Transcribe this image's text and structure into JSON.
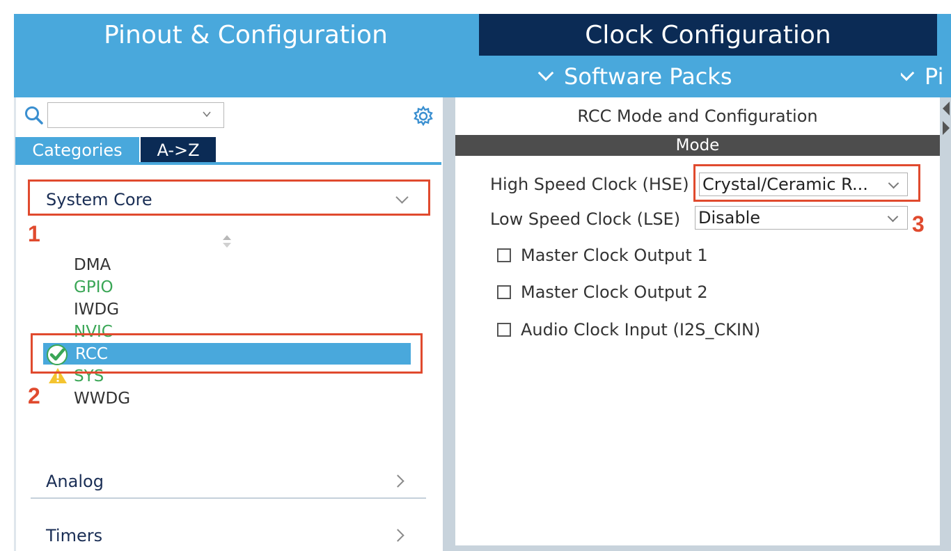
{
  "tabs": {
    "pinout": "Pinout & Configuration",
    "clock": "Clock Configuration"
  },
  "subbar": {
    "software_packs": "Software Packs",
    "pinout_partial": "Pi"
  },
  "left": {
    "search": {
      "value": "",
      "placeholder": ""
    },
    "view_tabs": {
      "categories": "Categories",
      "az": "A->Z"
    },
    "categories": [
      {
        "label": "System Core",
        "expanded": true
      },
      {
        "label": "Analog",
        "expanded": false
      },
      {
        "label": "Timers",
        "expanded": false
      }
    ],
    "peripherals": [
      {
        "label": "DMA",
        "color": "#333333",
        "status": "none"
      },
      {
        "label": "GPIO",
        "color": "#3aa656",
        "status": "none"
      },
      {
        "label": "IWDG",
        "color": "#333333",
        "status": "none"
      },
      {
        "label": "NVIC",
        "color": "#3aa656",
        "status": "none"
      },
      {
        "label": "RCC",
        "color": "#ffffff",
        "status": "ok-check",
        "selected": true
      },
      {
        "label": "SYS",
        "color": "#3aa656",
        "status": "warning"
      },
      {
        "label": "WWDG",
        "color": "#333333",
        "status": "none"
      }
    ]
  },
  "annotations": {
    "n1": "1",
    "n2": "2",
    "n3": "3",
    "color": "#e04a2e"
  },
  "right": {
    "title": "RCC Mode and Configuration",
    "mode_header": "Mode",
    "hse_label": "High Speed Clock (HSE)",
    "hse_value": "Crystal/Ceramic R...",
    "lse_label": "Low Speed Clock (LSE)",
    "lse_value": "Disable",
    "checkboxes": [
      {
        "label": "Master Clock Output 1",
        "checked": false
      },
      {
        "label": "Master Clock Output 2",
        "checked": false
      },
      {
        "label": "Audio Clock Input (I2S_CKIN)",
        "checked": false
      }
    ]
  },
  "colors": {
    "accent": "#49a8dc",
    "dark_navy": "#0b2b55",
    "mode_bar": "#4d4d4d",
    "green": "#3aa656",
    "warning": "#f4c430"
  }
}
